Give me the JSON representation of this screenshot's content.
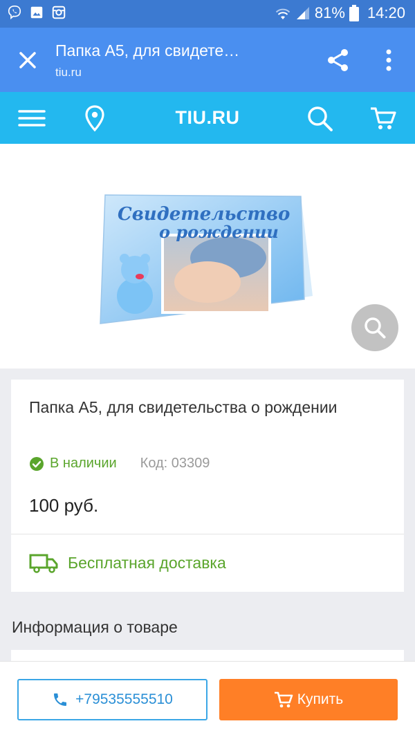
{
  "status_bar": {
    "battery": "81%",
    "time": "14:20"
  },
  "browser": {
    "title": "Папка А5, для свидете…",
    "url": "tiu.ru"
  },
  "site": {
    "logo": "TIU.RU"
  },
  "product": {
    "title": "Папка А5, для свидетельства о рождении",
    "stock": "В наличии",
    "code": "Код: 03309",
    "price": "100 руб.",
    "delivery": "Бесплатная доставка",
    "image_text_line1": "Свидетельство",
    "image_text_line2": "о рождении"
  },
  "section": {
    "info_title": "Информация о товаре"
  },
  "actions": {
    "phone": "+79535555510",
    "buy": "Купить"
  },
  "colors": {
    "status_bar": "#3c7ad1",
    "browser_bar": "#4a8ff0",
    "site_header": "#23b8ef",
    "green": "#5aa52c",
    "buy": "#ff7f26",
    "phone_border": "#3aa6e6"
  }
}
